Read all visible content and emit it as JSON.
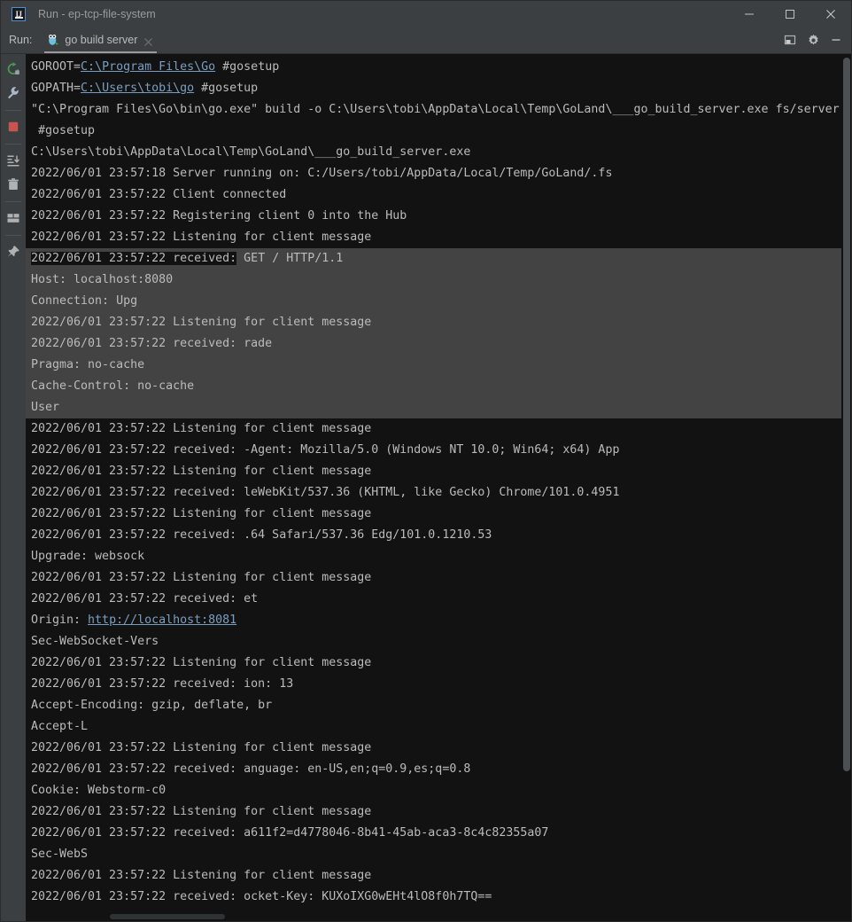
{
  "window": {
    "title": "Run - ep-tcp-file-system",
    "app_icon": "intellij-idea-icon",
    "controls": [
      {
        "name": "minimize-button",
        "icon": "minimize-icon"
      },
      {
        "name": "maximize-button",
        "icon": "maximize-icon"
      },
      {
        "name": "close-button",
        "icon": "close-icon"
      }
    ]
  },
  "tabbar": {
    "run_label": "Run:",
    "tab": {
      "label": "go build server",
      "icon": "go-gopher-icon",
      "close_icon": "close-icon",
      "active": true
    },
    "right_buttons": [
      {
        "name": "hide-toolwindow-button",
        "icon": "panel-layout-icon"
      },
      {
        "name": "settings-button",
        "icon": "gear-icon"
      },
      {
        "name": "minimize-toolwindow-button",
        "icon": "minus-icon"
      }
    ]
  },
  "gutter": {
    "buttons": [
      {
        "name": "rerun-button",
        "icon": "rerun-arrow-icon",
        "color": "#499c54"
      },
      {
        "name": "edit-configuration-button",
        "icon": "wrench-icon",
        "color": "#a9b7c6"
      },
      {
        "name": "stop-button",
        "icon": "stop-square-icon",
        "color": "#c75450"
      },
      {
        "name": "scroll-to-end-button",
        "icon": "scroll-to-end-icon",
        "color": "#afb1b3"
      },
      {
        "name": "clear-all-button",
        "icon": "trash-icon",
        "color": "#afb1b3"
      },
      {
        "name": "soft-wrap-button",
        "icon": "soft-wrap-icon",
        "color": "#afb1b3"
      },
      {
        "name": "pin-tab-button",
        "icon": "pin-icon",
        "color": "#afb1b3"
      }
    ]
  },
  "colors": {
    "console_bg": "#121212",
    "selection_bg": "#434343",
    "text": "#bbbbbb",
    "link": "#7a9ec2",
    "chrome_bg": "#3c3f41"
  },
  "console": {
    "lines": [
      {
        "selected": false,
        "parts": [
          {
            "text": "GOROOT="
          },
          {
            "text": "C:\\Program Files\\Go",
            "link": true
          },
          {
            "text": " #gosetup"
          }
        ]
      },
      {
        "selected": false,
        "parts": [
          {
            "text": "GOPATH="
          },
          {
            "text": "C:\\Users\\tobi\\go",
            "link": true
          },
          {
            "text": " #gosetup"
          }
        ]
      },
      {
        "selected": false,
        "parts": [
          {
            "text": "\"C:\\Program Files\\Go\\bin\\go.exe\" build -o C:\\Users\\tobi\\AppData\\Local\\Temp\\GoLand\\___go_build_server.exe fs/server"
          }
        ]
      },
      {
        "selected": false,
        "parts": [
          {
            "text": " #gosetup"
          }
        ]
      },
      {
        "selected": false,
        "parts": [
          {
            "text": "C:\\Users\\tobi\\AppData\\Local\\Temp\\GoLand\\___go_build_server.exe"
          }
        ]
      },
      {
        "selected": false,
        "parts": [
          {
            "text": "2022/06/01 23:57:18 Server running on: C:/Users/tobi/AppData/Local/Temp/GoLand/.fs"
          }
        ]
      },
      {
        "selected": false,
        "parts": [
          {
            "text": "2022/06/01 23:57:22 Client connected"
          }
        ]
      },
      {
        "selected": false,
        "parts": [
          {
            "text": "2022/06/01 23:57:22 Registering client 0 into the Hub"
          }
        ]
      },
      {
        "selected": false,
        "parts": [
          {
            "text": "2022/06/01 23:57:22 Listening for client message"
          }
        ]
      },
      {
        "selected": true,
        "parts": [
          {
            "text": "2022/06/01 23:57:22 received:",
            "unselected": true
          },
          {
            "text": " GET / HTTP/1.1"
          }
        ]
      },
      {
        "selected": true,
        "parts": [
          {
            "text": "Host: localhost:8080"
          }
        ]
      },
      {
        "selected": true,
        "parts": [
          {
            "text": "Connection: Upg"
          }
        ]
      },
      {
        "selected": true,
        "parts": [
          {
            "text": "2022/06/01 23:57:22 Listening for client message"
          }
        ]
      },
      {
        "selected": true,
        "parts": [
          {
            "text": "2022/06/01 23:57:22 received: rade"
          }
        ]
      },
      {
        "selected": true,
        "parts": [
          {
            "text": "Pragma: no-cache"
          }
        ]
      },
      {
        "selected": true,
        "parts": [
          {
            "text": "Cache-Control: no-cache"
          }
        ]
      },
      {
        "selected": true,
        "parts": [
          {
            "text": "User"
          }
        ]
      },
      {
        "selected": false,
        "parts": [
          {
            "text": "2022/06/01 23:57:22 Listening for client message"
          }
        ]
      },
      {
        "selected": false,
        "parts": [
          {
            "text": "2022/06/01 23:57:22 received: -Agent: Mozilla/5.0 (Windows NT 10.0; Win64; x64) App"
          }
        ]
      },
      {
        "selected": false,
        "parts": [
          {
            "text": "2022/06/01 23:57:22 Listening for client message"
          }
        ]
      },
      {
        "selected": false,
        "parts": [
          {
            "text": "2022/06/01 23:57:22 received: leWebKit/537.36 (KHTML, like Gecko) Chrome/101.0.4951"
          }
        ]
      },
      {
        "selected": false,
        "parts": [
          {
            "text": "2022/06/01 23:57:22 Listening for client message"
          }
        ]
      },
      {
        "selected": false,
        "parts": [
          {
            "text": "2022/06/01 23:57:22 received: .64 Safari/537.36 Edg/101.0.1210.53"
          }
        ]
      },
      {
        "selected": false,
        "parts": [
          {
            "text": "Upgrade: websock"
          }
        ]
      },
      {
        "selected": false,
        "parts": [
          {
            "text": "2022/06/01 23:57:22 Listening for client message"
          }
        ]
      },
      {
        "selected": false,
        "parts": [
          {
            "text": "2022/06/01 23:57:22 received: et"
          }
        ]
      },
      {
        "selected": false,
        "parts": [
          {
            "text": "Origin: "
          },
          {
            "text": "http://localhost:8081",
            "link": true
          }
        ]
      },
      {
        "selected": false,
        "parts": [
          {
            "text": "Sec-WebSocket-Vers"
          }
        ]
      },
      {
        "selected": false,
        "parts": [
          {
            "text": "2022/06/01 23:57:22 Listening for client message"
          }
        ]
      },
      {
        "selected": false,
        "parts": [
          {
            "text": "2022/06/01 23:57:22 received: ion: 13"
          }
        ]
      },
      {
        "selected": false,
        "parts": [
          {
            "text": "Accept-Encoding: gzip, deflate, br"
          }
        ]
      },
      {
        "selected": false,
        "parts": [
          {
            "text": "Accept-L"
          }
        ]
      },
      {
        "selected": false,
        "parts": [
          {
            "text": "2022/06/01 23:57:22 Listening for client message"
          }
        ]
      },
      {
        "selected": false,
        "parts": [
          {
            "text": "2022/06/01 23:57:22 received: anguage: en-US,en;q=0.9,es;q=0.8"
          }
        ]
      },
      {
        "selected": false,
        "parts": [
          {
            "text": "Cookie: Webstorm-c0"
          }
        ]
      },
      {
        "selected": false,
        "parts": [
          {
            "text": "2022/06/01 23:57:22 Listening for client message"
          }
        ]
      },
      {
        "selected": false,
        "parts": [
          {
            "text": "2022/06/01 23:57:22 received: a611f2=d4778046-8b41-45ab-aca3-8c4c82355a07"
          }
        ]
      },
      {
        "selected": false,
        "parts": [
          {
            "text": "Sec-WebS"
          }
        ]
      },
      {
        "selected": false,
        "parts": [
          {
            "text": "2022/06/01 23:57:22 Listening for client message"
          }
        ]
      },
      {
        "selected": false,
        "parts": [
          {
            "text": "2022/06/01 23:57:22 received: ocket-Key: KUXoIXG0wEHt4lO8f0h7TQ=="
          }
        ]
      }
    ]
  }
}
